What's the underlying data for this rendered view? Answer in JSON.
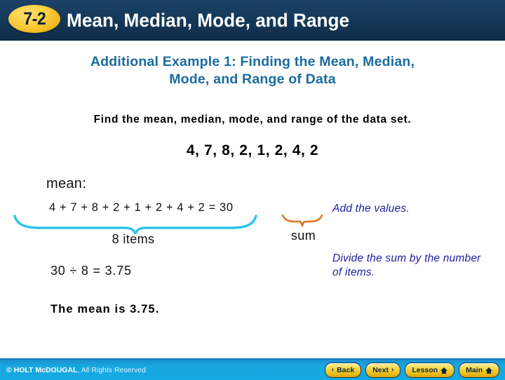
{
  "header": {
    "lesson_badge": "7-2",
    "title": "Mean, Median, Mode, and Range"
  },
  "subtitle": {
    "line1": "Additional Example 1: Finding the Mean, Median,",
    "line2": "Mode, and Range of Data"
  },
  "body": {
    "prompt": "Find the mean, median, mode, and range of the data set.",
    "dataset": "4, 7, 8, 2, 1, 2, 4, 2",
    "mean_label": "mean:",
    "sum_equation": "4 + 7 + 8 + 2 + 1 + 2 + 4 + 2 = 30",
    "items_label": "8 items",
    "sum_label": "sum",
    "division_line": "30 ÷ 8 = 3.75",
    "conclusion": "The mean is 3.75."
  },
  "annotations": {
    "add_values": "Add the values.",
    "divide": "Divide the sum by the number of items."
  },
  "footer": {
    "copyright_strong": "© HOLT McDOUGAL",
    "copyright_light": ", All Rights Reserved",
    "buttons": [
      {
        "label": "Back",
        "icon": "chevron-left-icon",
        "glyph": "‹"
      },
      {
        "label": "Next",
        "icon": "chevron-right-icon",
        "glyph": "›"
      },
      {
        "label": "Lesson",
        "icon": "home-icon",
        "glyph": ""
      },
      {
        "label": "Main",
        "icon": "home-icon",
        "glyph": ""
      }
    ]
  },
  "colors": {
    "header_bg": "#15395a",
    "badge": "#fdd042",
    "subtitle": "#1a6c9e",
    "annotation": "#1c1ca0",
    "brace_items": "#2ec3ee",
    "brace_sum": "#e07b28",
    "footer_bg": "#16a9e2",
    "button": "#f6d748"
  }
}
